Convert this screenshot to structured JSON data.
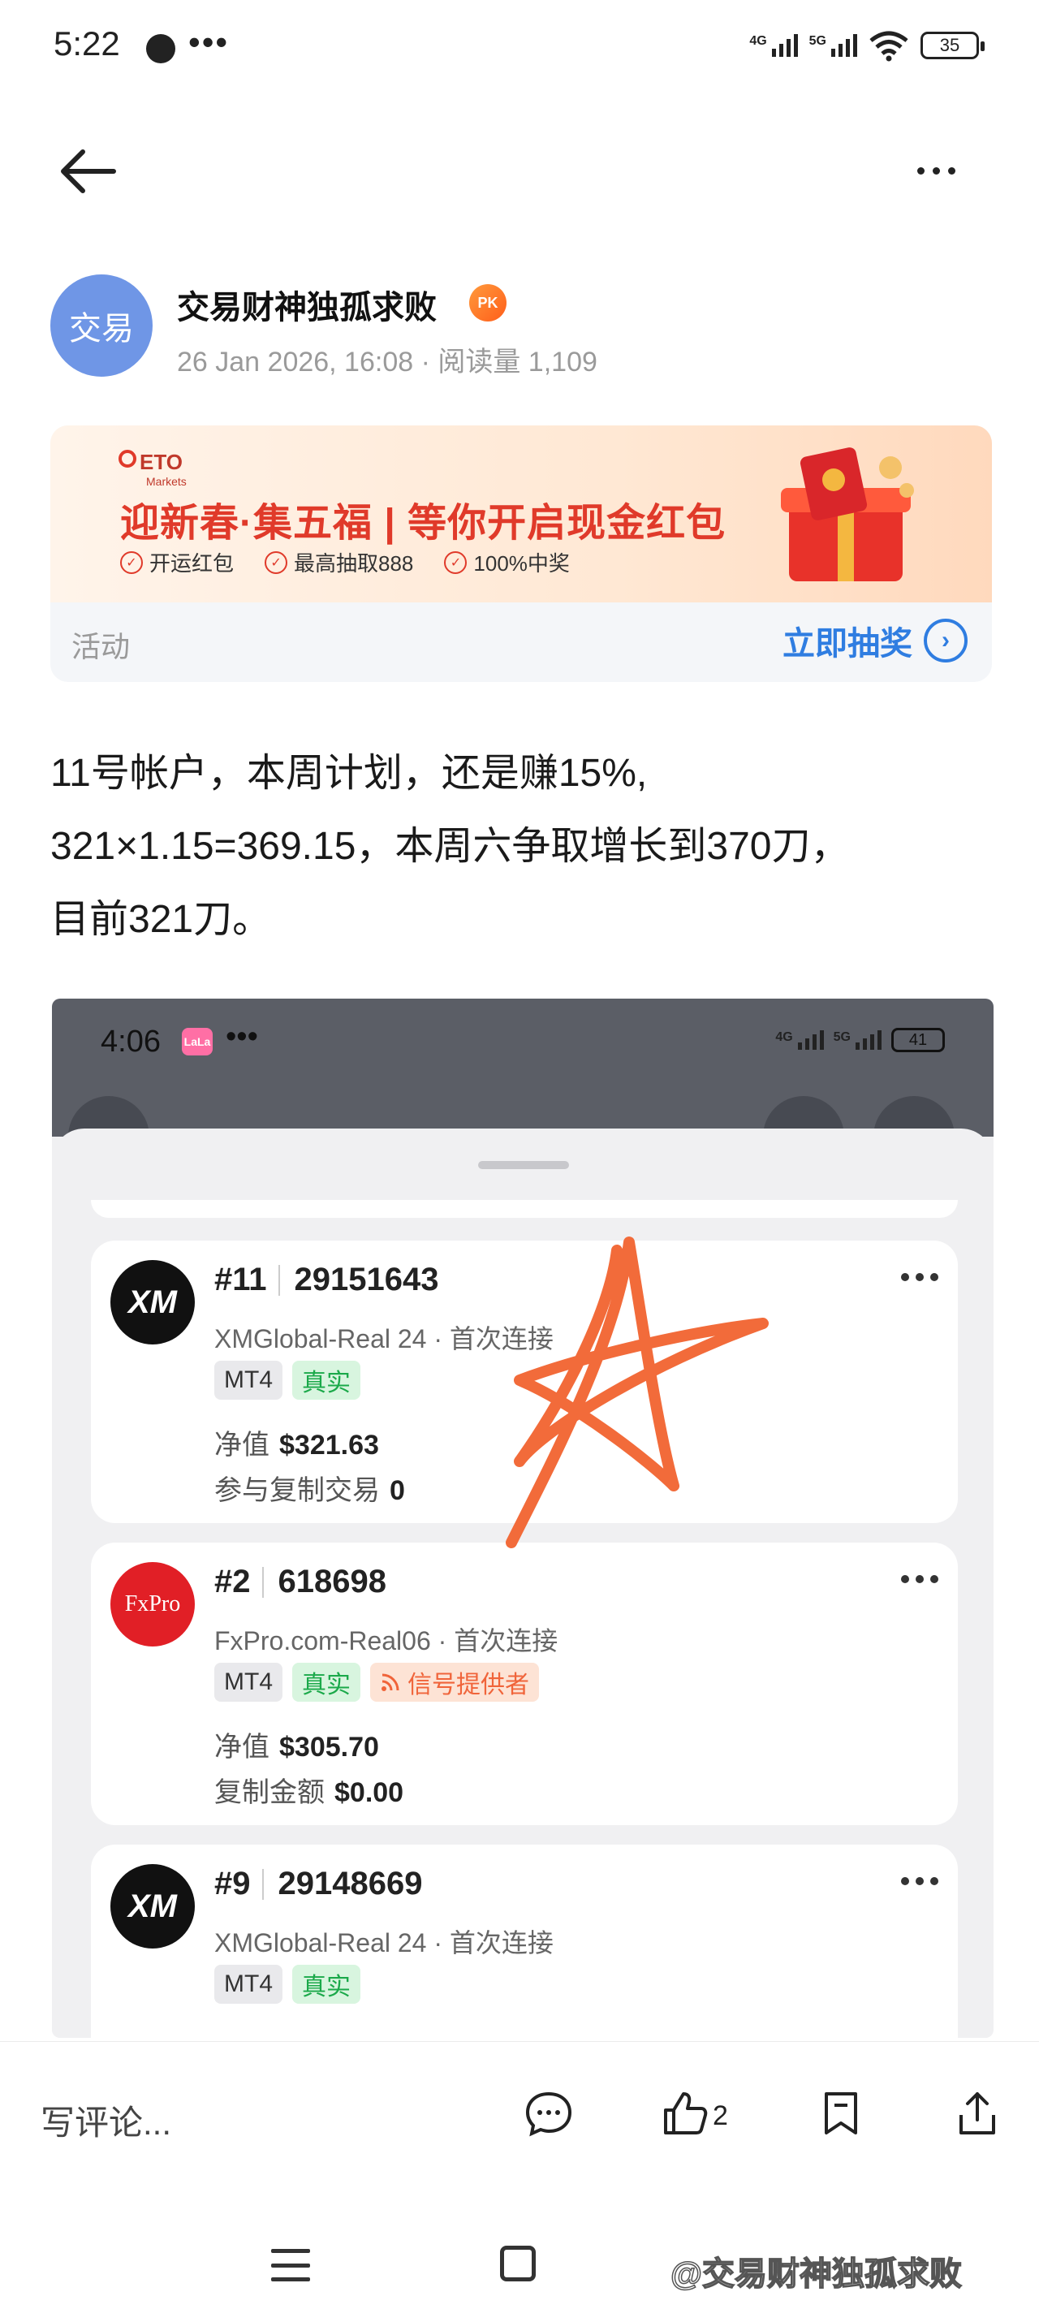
{
  "status_bar": {
    "time": "5:22",
    "dots": "•••",
    "net1": "4G",
    "net2": "5G",
    "battery": "35"
  },
  "nav": {
    "back_icon": "arrow-left-icon",
    "more_icon": "more-horizontal-icon"
  },
  "author": {
    "avatar_text": "交易",
    "name": "交易财神独孤求败",
    "badge": "PK",
    "meta": "26 Jan 2026, 16:08 · 阅读量 1,109"
  },
  "ad": {
    "logo": "ETO",
    "logo_sub": "Markets",
    "headline": "迎新春·集五福 | 等你开启现金红包",
    "perks": [
      "开运红包",
      "最高抽取888",
      "100%中奖"
    ],
    "tag": "活动",
    "cta": "立即抽奖",
    "accent": "#e03a2a",
    "cta_color": "#2f7de1"
  },
  "post": {
    "lines": [
      "11号帐户，本周计划，还是赚15%,",
      "321×1.15=369.15，本周六争取增长到370刀，",
      "目前321刀。"
    ]
  },
  "screenshot": {
    "time": "4:06",
    "app_badge": "LaLa",
    "dots": "•••",
    "net1": "4G",
    "net2": "5G",
    "battery": "41",
    "accounts": [
      {
        "logo": "XM",
        "number": "#11",
        "login": "29151643",
        "server": "XMGlobal-Real 24 · 首次连接",
        "tags": [
          "MT4",
          "真实"
        ],
        "line1_label": "净值",
        "line1_value": "$321.63",
        "line2_label": "参与复制交易",
        "line2_value": "0"
      },
      {
        "logo": "FxPro",
        "number": "#2",
        "login": "618698",
        "server": "FxPro.com-Real06 · 首次连接",
        "tags": [
          "MT4",
          "真实",
          "信号提供者"
        ],
        "line1_label": "净值",
        "line1_value": "$305.70",
        "line2_label": "复制金额",
        "line2_value": "$0.00"
      },
      {
        "logo": "XM",
        "number": "#9",
        "login": "29148669",
        "server": "XMGlobal-Real 24 · 首次连接",
        "tags": [
          "MT4",
          "真实"
        ]
      }
    ]
  },
  "bottom_bar": {
    "comment_placeholder": "写评论...",
    "like_count": "2",
    "icons": [
      "comment-icon",
      "thumbs-up-icon",
      "bookmark-icon",
      "share-icon"
    ]
  },
  "watermark": "@交易财神独孤求败"
}
